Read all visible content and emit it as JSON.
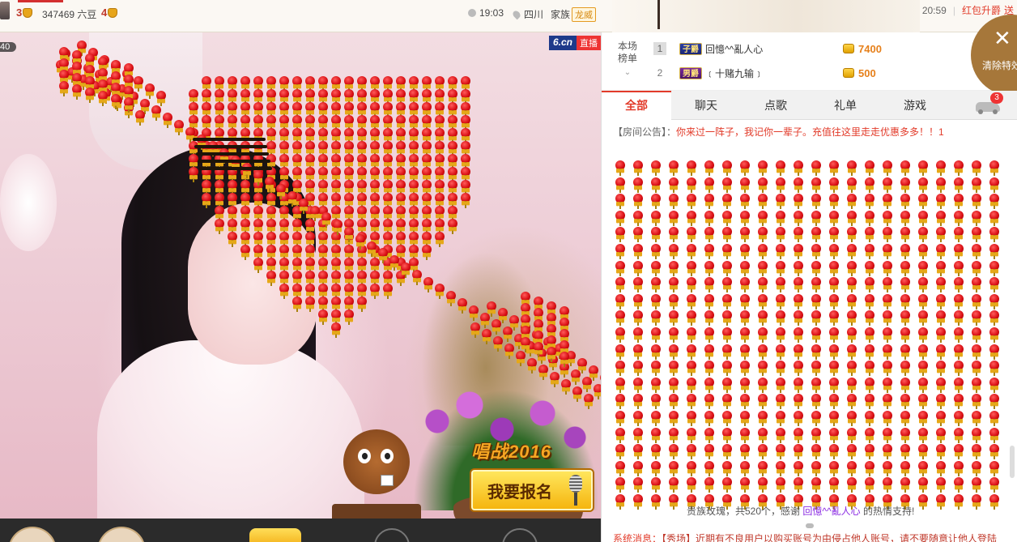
{
  "topbar": {
    "level_left": "3",
    "room_id_label": "347469 六豆",
    "level_right": "4",
    "time": "19:03",
    "location": "四川",
    "family_label": "家族",
    "family_badge": "龙威"
  },
  "right_top": {
    "time": "20:59",
    "separator": "|",
    "link": "红包升爵",
    "extra": "送"
  },
  "video": {
    "viewer_count": "40",
    "channel_brand": "6.cn",
    "channel_live": "直播",
    "promo_title": "唱战2016",
    "promo_button": "我要报名"
  },
  "rank": {
    "label_line1": "本场",
    "label_line2": "榜单",
    "chevron": "⌄",
    "rows": [
      {
        "num": "1",
        "badge": "子爵",
        "name": "回憶^^亂人心",
        "score": "7400"
      },
      {
        "num": "2",
        "badge": "男爵",
        "name": "﹝十赌九输﹞",
        "score": "500"
      }
    ]
  },
  "clear_fx": {
    "icon": "✕",
    "label": "清除特效"
  },
  "tabs": [
    {
      "label": "全部",
      "active": true
    },
    {
      "label": "聊天",
      "active": false
    },
    {
      "label": "点歌",
      "active": false
    },
    {
      "label": "礼单",
      "active": false
    },
    {
      "label": "游戏",
      "active": false
    }
  ],
  "car_badge": "3",
  "notice": {
    "tag": "【房间公告】：",
    "message": "你来过一阵子，我记你一辈子。充值往这里走走优惠多多！！1"
  },
  "thank_line": {
    "prefix": "贵族玫瑰，共520个，感谢",
    "user": "回憶^^亂人心",
    "suffix": "的热情支持!"
  },
  "sys_msg": {
    "label": "系统消息：",
    "text": "【秀场】近期有不良用户以购买账号为由侵占他人账号，请不要随意让他人登陆"
  },
  "colors": {
    "accent_red": "#e23b2a",
    "gold": "#e6801b",
    "rose_red": "#d90f14",
    "clear_fx_bg": "#a6773a"
  }
}
